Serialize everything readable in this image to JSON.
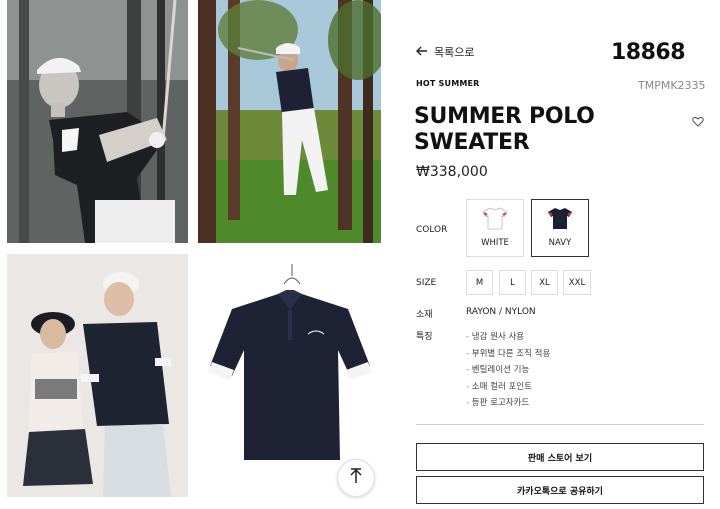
{
  "nav": {
    "back_label": "목록으로"
  },
  "product": {
    "number": "18868",
    "collection": "HOT SUMMER",
    "sku": "TMPMK2335",
    "title_line1": "SUMMER POLO",
    "title_line2": "SWEATER",
    "price": "₩338,000"
  },
  "color": {
    "label": "COLOR",
    "options": [
      {
        "name": "WHITE",
        "swatch": "#ffffff",
        "accent": "#e53935"
      },
      {
        "name": "NAVY",
        "swatch": "#1c2233",
        "accent": "#e53935"
      }
    ],
    "selected": "NAVY"
  },
  "size": {
    "label": "SIZE",
    "options": [
      "M",
      "L",
      "XL",
      "XXL"
    ]
  },
  "material": {
    "label": "소재",
    "value": "RAYON / NYLON"
  },
  "features": {
    "label": "특징",
    "items": [
      "냉감 원사 사용",
      "부위별 다른 조직 적용",
      "벤틸레이션 기능",
      "소매 컬러 포인트",
      "등판 로고자카드"
    ]
  },
  "actions": {
    "store_button": "판매 스토어 보기",
    "share_button": "카카오톡으로 공유하기"
  },
  "icons": [
    "arrow-left-icon",
    "heart-icon",
    "arrow-up-icon"
  ]
}
